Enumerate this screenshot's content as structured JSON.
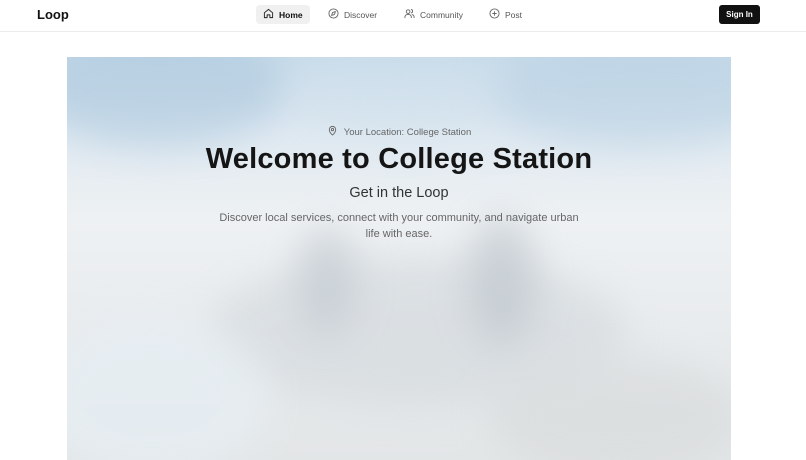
{
  "nav": {
    "logo": "Loop",
    "items": [
      {
        "label": "Home",
        "icon": "home-icon",
        "active": true
      },
      {
        "label": "Discover",
        "icon": "compass-icon",
        "active": false
      },
      {
        "label": "Community",
        "icon": "users-icon",
        "active": false
      },
      {
        "label": "Post",
        "icon": "plus-circle-icon",
        "active": false
      }
    ],
    "signin_label": "Sign In"
  },
  "hero": {
    "location_text": "Your Location: College Station",
    "location_icon": "map-pin-icon",
    "title": "Welcome to College Station",
    "subtitle": "Get in the Loop",
    "description": "Discover local services, connect with your community, and navigate urban life with ease."
  },
  "colors": {
    "primary_button": "#111111",
    "active_nav_bg": "#f0f0f0"
  }
}
